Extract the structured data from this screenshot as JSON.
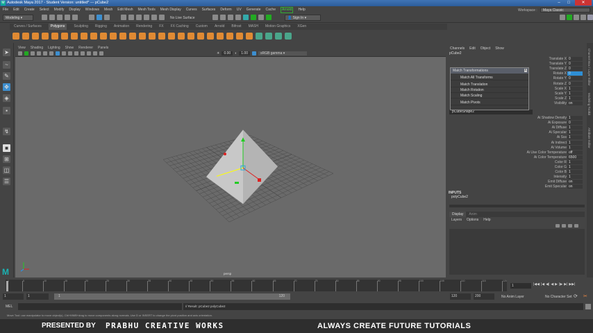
{
  "window": {
    "title": "Autodesk Maya 2017 - Student Version: untitled*   ---   pCube2",
    "minimize": "–",
    "maximize": "□",
    "close": "✕"
  },
  "menubar": [
    "File",
    "Edit",
    "Create",
    "Select",
    "Modify",
    "Display",
    "Windows",
    "Mesh",
    "Edit Mesh",
    "Mesh Tools",
    "Mesh Display",
    "Curves",
    "Surfaces",
    "Deform",
    "UV",
    "Generate",
    "Cache",
    "Arnold",
    "Help"
  ],
  "status": {
    "mode": "Modeling",
    "live_surface": "No Live Surface",
    "sign_in": "Sign In",
    "workspace_label": "Workspace :",
    "workspace": "Maya Classic"
  },
  "shelf_tabs": [
    "Curves / Surfaces",
    "Polygons",
    "Sculpting",
    "Rigging",
    "Animation",
    "Rendering",
    "FX",
    "FX Caching",
    "Custom",
    "Arnold",
    "Bifrost",
    "MASH",
    "Motion Graphics",
    "XGen"
  ],
  "shelf_active": "Polygons",
  "panel_menu": [
    "View",
    "Shading",
    "Lighting",
    "Show",
    "Renderer",
    "Panels"
  ],
  "panel_fields": {
    "exposure": "0.00",
    "gamma": "1.00",
    "colorspace": "sRGB gamma"
  },
  "viewport": {
    "camera": "persp",
    "accent": "#2e8fd6"
  },
  "channel_box": {
    "menu": [
      "Channels",
      "Edit",
      "Object",
      "Show"
    ],
    "object": "pCube2",
    "attrs": [
      [
        "Translate X",
        "0"
      ],
      [
        "Translate Y",
        "0"
      ],
      [
        "Translate Z",
        "0"
      ],
      [
        "Rotate X",
        "0"
      ],
      [
        "Rotate Y",
        "0"
      ],
      [
        "Rotate Z",
        "0"
      ],
      [
        "Scale X",
        "1"
      ],
      [
        "Scale Y",
        "1"
      ],
      [
        "Scale Z",
        "1"
      ],
      [
        "Visibility",
        "on"
      ]
    ],
    "shape": "pCubeShape2",
    "shape_attrs": [
      [
        "Ai Shadow Density",
        "1"
      ],
      [
        "Ai Exposure",
        "0"
      ],
      [
        "Ai Diffuse",
        "1"
      ],
      [
        "Ai Specular",
        "1"
      ],
      [
        "Ai Sss",
        "1"
      ],
      [
        "Ai Indirect",
        "1"
      ],
      [
        "Ai Volume",
        "1"
      ],
      [
        "Ai Use Color Temperature",
        "off"
      ],
      [
        "Ai Color Temperature",
        "6500"
      ],
      [
        "Color R",
        "1"
      ],
      [
        "Color G",
        "1"
      ],
      [
        "Color B",
        "1"
      ],
      [
        "Intensity",
        "1"
      ],
      [
        "Emit Diffuse",
        "on"
      ],
      [
        "Emit Specular",
        "on"
      ]
    ],
    "inputs_label": "INPUTS",
    "input": "polyCube2"
  },
  "popup": {
    "title": "Match Transformations",
    "close": "x",
    "items": [
      "Match All Transforms",
      "Match Translation",
      "Match Rotation",
      "Match Scaling",
      "Match Pivots"
    ]
  },
  "layers": {
    "tabs": [
      "Display",
      "Anim"
    ],
    "menu": [
      "Layers",
      "Options",
      "Help"
    ]
  },
  "side_tabs": [
    "Channel Box / Layer Editor",
    "Modeling Toolkit",
    "Attribute Editor"
  ],
  "timeline": {
    "ticks": [
      "1",
      "5",
      "10",
      "15",
      "20",
      "25",
      "30",
      "35",
      "40",
      "45",
      "50",
      "55",
      "60",
      "65",
      "70",
      "75",
      "80",
      "85",
      "90",
      "95",
      "100",
      "105",
      "110",
      "115",
      "120"
    ],
    "current": "1",
    "controls": [
      "|◀◀",
      "|◀",
      "◀|",
      "◀",
      "▶",
      "|▶",
      "▶|",
      "▶▶|"
    ]
  },
  "range": {
    "start": "1",
    "current": "1",
    "slider_start": "1",
    "slider_end": "120",
    "end": "120",
    "max": "200",
    "anim_layer": "No Anim Layer",
    "char_set": "No Character Set"
  },
  "command": {
    "label": "MEL",
    "result": "// Result: pCube2 polyCube2"
  },
  "help_line": "Move Tool: use manipulator to move object(s). Ctrl+MMB+drag to move components along normals. Use D or INSERT to change the pivot position and axis orientation.",
  "banner": {
    "presented": "PRESENTED BY",
    "brand": "PRABHU CREATIVE WORKS",
    "tagline": "ALWAYS CREATE FUTURE TUTORIALS"
  }
}
